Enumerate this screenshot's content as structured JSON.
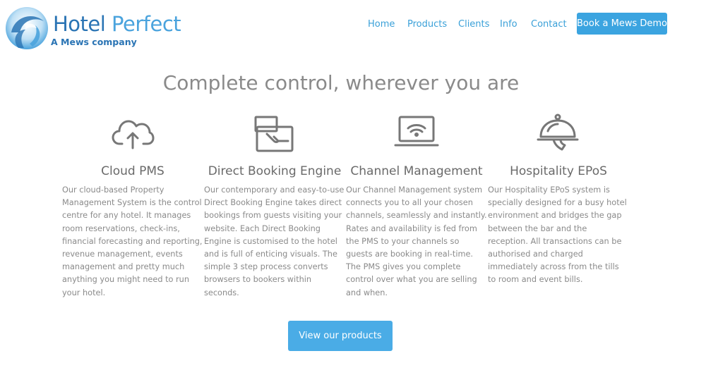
{
  "brand": {
    "name_part1": "Hotel",
    "name_part2": "Perfect",
    "tagline": "A Mews company",
    "primary_color": "#2a74b4",
    "secondary_color": "#4aa3dd"
  },
  "nav": {
    "items": [
      {
        "label": "Home"
      },
      {
        "label": "Products"
      },
      {
        "label": "Clients"
      },
      {
        "label": "Info"
      },
      {
        "label": "Contact"
      }
    ],
    "cta_label": "Book a Mews Demo",
    "link_color": "#3aa0d8",
    "button_color": "#3ba4e0"
  },
  "headline": "Complete control, wherever you are",
  "features": [
    {
      "icon": "cloud-upload-icon",
      "title": "Cloud PMS",
      "description": "Our cloud-based Property Management System is the control centre for any hotel. It manages room reservations, check-ins, financial forecasting and reporting, revenue management, events management and pretty much anything you might need to run your hotel."
    },
    {
      "icon": "card-payment-icon",
      "title": "Direct Booking Engine",
      "description": "Our contemporary and easy-to-use Direct Booking Engine takes direct bookings from guests visiting your website. Each Direct Booking Engine is customised to the hotel and is full of enticing visuals. The simple 3 step process converts browsers to bookers within seconds."
    },
    {
      "icon": "laptop-wifi-icon",
      "title": "Channel Management",
      "description": "Our Channel Management system connects you to all your chosen channels, seamlessly and instantly. Rates and availability is fed from the PMS to your channels so guests are booking in real-time. The PMS gives you complete control over what you are selling and when."
    },
    {
      "icon": "serving-cloche-icon",
      "title": "Hospitality EPoS",
      "description": "Our Hospitality EPoS system is specially designed for a busy hotel environment and bridges the gap between the bar and the reception. All transactions can be authorised and charged immediately across from the tills to room and event bills."
    }
  ],
  "cta": {
    "label": "View our products",
    "color": "#4aace6"
  }
}
